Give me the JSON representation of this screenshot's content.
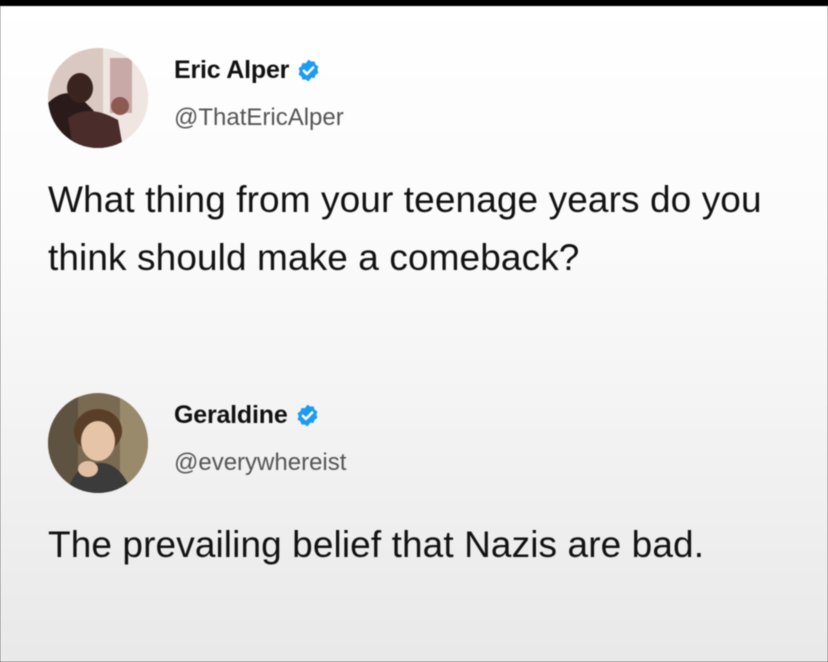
{
  "tweets": [
    {
      "display_name": "Eric Alper",
      "handle": "@ThatEricAlper",
      "verified": true,
      "avatar_icon": "profile-photo-icon",
      "text": "What thing from your teenage years do you think should make a comeback?"
    },
    {
      "display_name": "Geraldine",
      "handle": "@everywhereist",
      "verified": true,
      "avatar_icon": "profile-photo-icon",
      "text": "The prevailing belief that Nazis are bad."
    }
  ],
  "colors": {
    "verified_badge": "#1d9bf0",
    "text": "#121212",
    "handle": "#555555"
  }
}
